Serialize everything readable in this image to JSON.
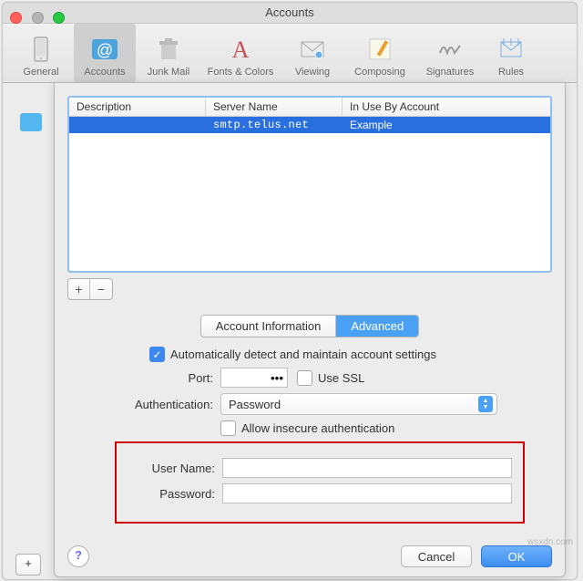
{
  "window": {
    "title": "Accounts"
  },
  "toolbar": {
    "items": [
      {
        "label": "General"
      },
      {
        "label": "Accounts",
        "selected": true
      },
      {
        "label": "Junk Mail"
      },
      {
        "label": "Fonts & Colors"
      },
      {
        "label": "Viewing"
      },
      {
        "label": "Composing"
      },
      {
        "label": "Signatures"
      },
      {
        "label": "Rules"
      }
    ]
  },
  "table": {
    "headers": {
      "c1": "Description",
      "c2": "Server Name",
      "c3": "In Use By Account"
    },
    "rows": [
      {
        "description": "",
        "server": "smtp.telus.net",
        "account": "Example"
      }
    ]
  },
  "tabs": {
    "info": "Account Information",
    "adv": "Advanced"
  },
  "form": {
    "auto_label": "Automatically detect and maintain account settings",
    "auto_checked": true,
    "port_label": "Port:",
    "port_value": "•••",
    "use_ssl_label": "Use SSL",
    "use_ssl_checked": false,
    "auth_label": "Authentication:",
    "auth_value": "Password",
    "insecure_label": "Allow insecure authentication",
    "insecure_checked": false,
    "user_label": "User Name:",
    "user_value": "",
    "pass_label": "Password:",
    "pass_value": ""
  },
  "buttons": {
    "cancel": "Cancel",
    "ok": "OK"
  },
  "watermark": "wsxdn.com"
}
